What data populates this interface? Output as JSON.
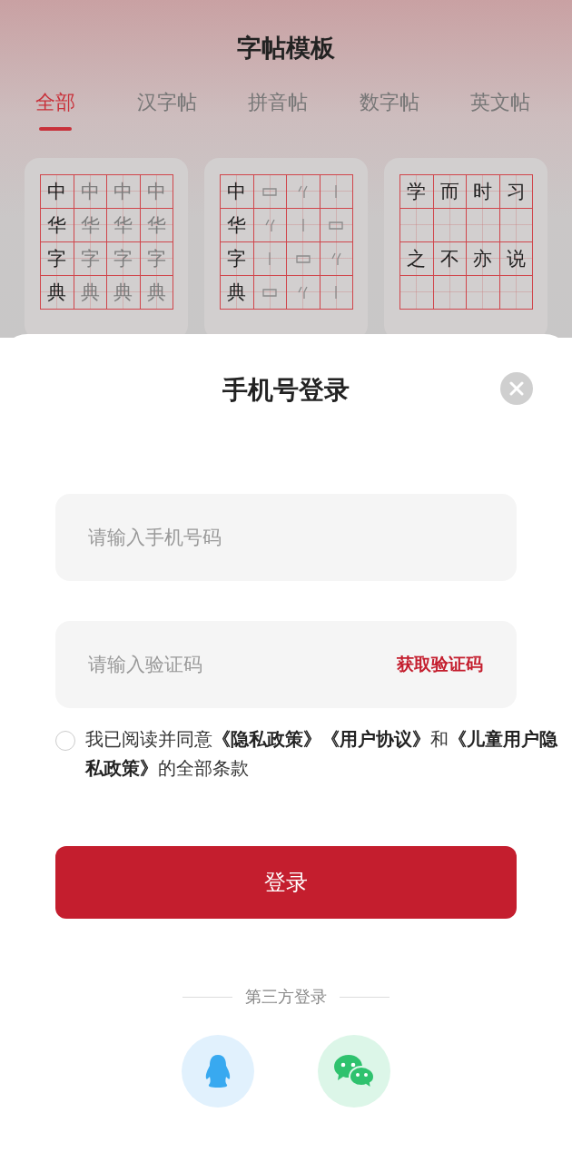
{
  "header": {
    "title": "字帖模板"
  },
  "tabs": [
    {
      "label": "全部",
      "selected": true
    },
    {
      "label": "汉字帖",
      "selected": false
    },
    {
      "label": "拼音帖",
      "selected": false
    },
    {
      "label": "数字帖",
      "selected": false
    },
    {
      "label": "英文帖",
      "selected": false
    }
  ],
  "templates": [
    {
      "rows": [
        [
          {
            "kind": "model",
            "text": "中"
          },
          {
            "kind": "trace",
            "text": "中"
          },
          {
            "kind": "trace",
            "text": "中"
          },
          {
            "kind": "trace",
            "text": "中"
          }
        ],
        [
          {
            "kind": "model",
            "text": "华"
          },
          {
            "kind": "trace",
            "text": "华"
          },
          {
            "kind": "trace",
            "text": "华"
          },
          {
            "kind": "trace",
            "text": "华"
          }
        ],
        [
          {
            "kind": "model",
            "text": "字"
          },
          {
            "kind": "trace",
            "text": "字"
          },
          {
            "kind": "trace",
            "text": "字"
          },
          {
            "kind": "trace",
            "text": "字"
          }
        ],
        [
          {
            "kind": "model",
            "text": "典"
          },
          {
            "kind": "trace",
            "text": "典"
          },
          {
            "kind": "trace",
            "text": "典"
          },
          {
            "kind": "trace",
            "text": "典"
          }
        ]
      ]
    },
    {
      "rows": [
        [
          {
            "kind": "model",
            "text": "中"
          },
          {
            "kind": "stroke"
          },
          {
            "kind": "stroke"
          },
          {
            "kind": "stroke"
          }
        ],
        [
          {
            "kind": "model",
            "text": "华"
          },
          {
            "kind": "stroke"
          },
          {
            "kind": "stroke"
          },
          {
            "kind": "stroke"
          }
        ],
        [
          {
            "kind": "model",
            "text": "字"
          },
          {
            "kind": "stroke"
          },
          {
            "kind": "stroke"
          },
          {
            "kind": "stroke"
          }
        ],
        [
          {
            "kind": "model",
            "text": "典"
          },
          {
            "kind": "stroke"
          },
          {
            "kind": "stroke"
          },
          {
            "kind": "stroke"
          }
        ]
      ]
    },
    {
      "rows": [
        [
          {
            "kind": "model",
            "text": "学"
          },
          {
            "kind": "model",
            "text": "而"
          },
          {
            "kind": "model",
            "text": "时"
          },
          {
            "kind": "model",
            "text": "习"
          }
        ],
        [
          {
            "kind": "blank"
          },
          {
            "kind": "blank"
          },
          {
            "kind": "blank"
          },
          {
            "kind": "blank"
          }
        ],
        [
          {
            "kind": "model",
            "text": "之"
          },
          {
            "kind": "model",
            "text": "不"
          },
          {
            "kind": "model",
            "text": "亦"
          },
          {
            "kind": "model",
            "text": "说"
          }
        ],
        [
          {
            "kind": "blank"
          },
          {
            "kind": "blank"
          },
          {
            "kind": "blank"
          },
          {
            "kind": "blank"
          }
        ]
      ]
    }
  ],
  "login": {
    "title": "手机号登录",
    "phone_field": {
      "placeholder": "请输入手机号码"
    },
    "code_field": {
      "placeholder": "请输入验证码",
      "action": "获取验证码"
    },
    "agreement": {
      "checked": false,
      "text": "我已阅读并同意**《隐私政策》《用户协议》**和**《儿童用户隐私政策》**的全部条款"
    },
    "submit": "登录",
    "third_party": {
      "label": "第三方登录",
      "providers": [
        {
          "kind": "qq"
        },
        {
          "kind": "wechat"
        }
      ]
    }
  }
}
